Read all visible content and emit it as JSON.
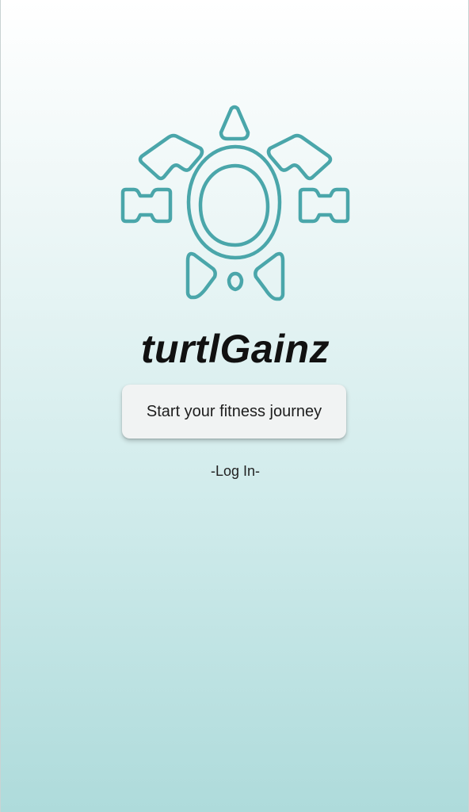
{
  "app": {
    "title": "turtlGainz",
    "logo_icon": "turtle-dumbbell-logo-icon",
    "accent_color": "#4aa6aa"
  },
  "actions": {
    "start_label": "Start your fitness journey",
    "login_label": "-Log In-"
  }
}
